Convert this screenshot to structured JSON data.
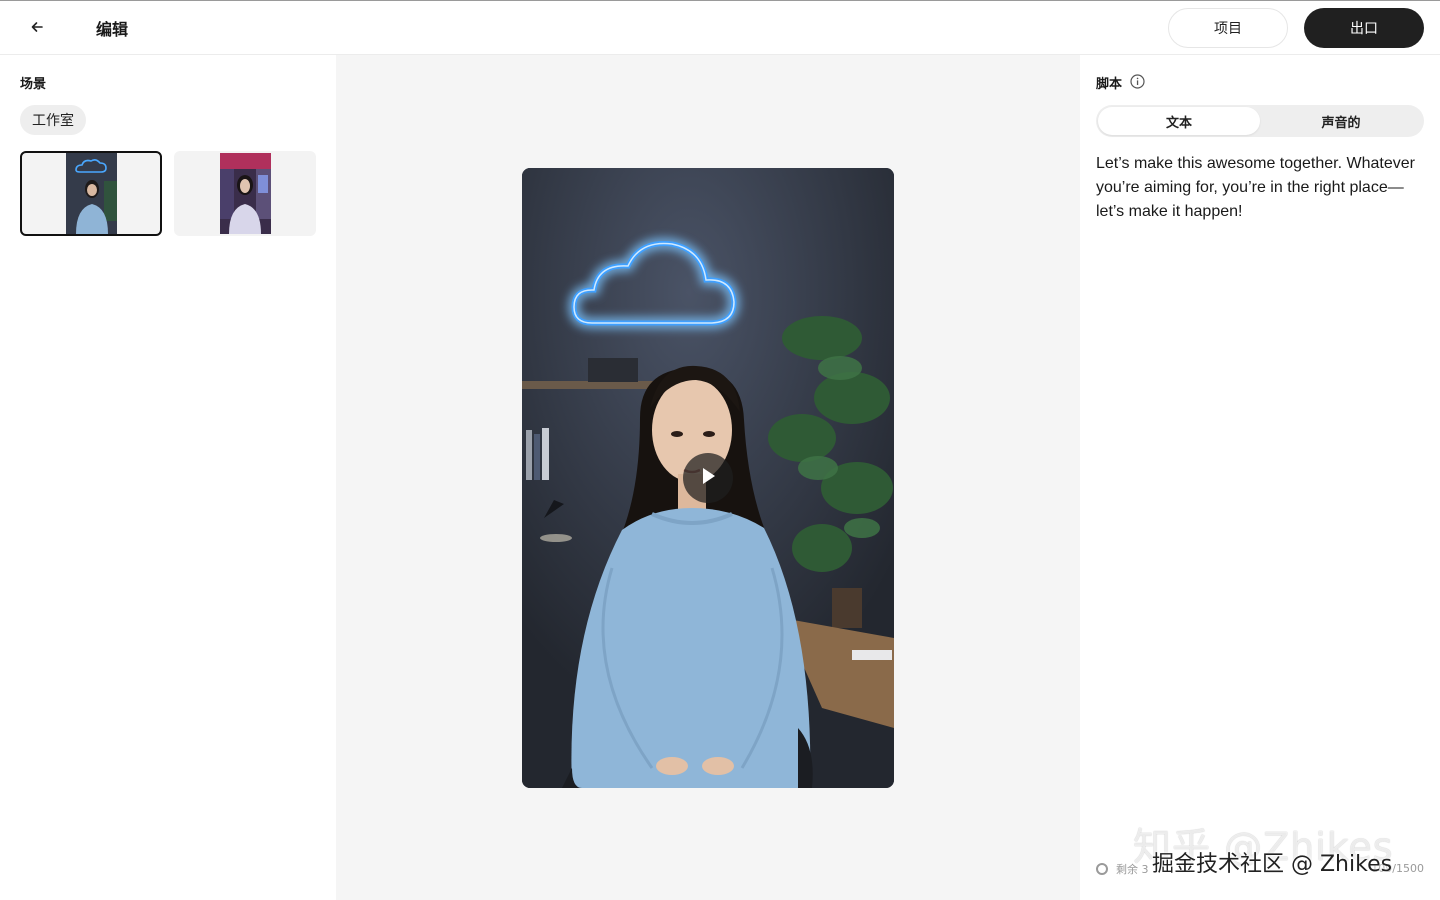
{
  "header": {
    "title": "编辑",
    "projects_label": "项目",
    "export_label": "出口"
  },
  "left": {
    "section_label": "场景",
    "chip_label": "工作室"
  },
  "right": {
    "section_label": "脚本",
    "tabs": [
      {
        "label": "文本",
        "active": true
      },
      {
        "label": "声音的",
        "active": false
      }
    ],
    "script_text": "Let’s make this awesome together. Whatever you’re aiming for, you’re in the right place—let’s make it happen!",
    "footer_left": "剩余 3",
    "footer_right": "109/1500"
  },
  "watermarks": {
    "line1": "知乎 @Zhikes",
    "line2": "掘金技术社区 @ Zhikes"
  },
  "icons": [
    "arrow-left-icon",
    "info-icon",
    "play-icon",
    "status-dot-icon"
  ],
  "colors": {
    "export_bg": "#202020",
    "canvas_bg": "#f5f5f5",
    "neon_blue": "#3fa0ff"
  }
}
